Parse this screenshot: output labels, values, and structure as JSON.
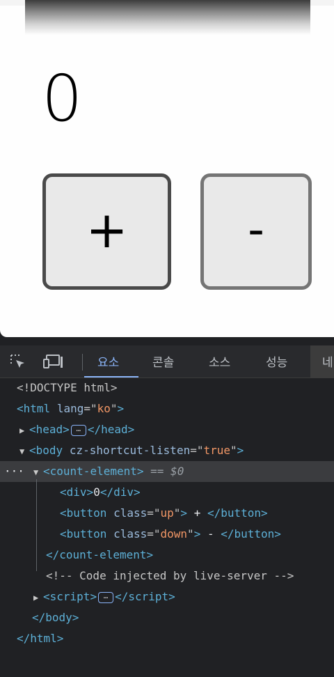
{
  "counter": {
    "value": "0",
    "plus_label": "+",
    "minus_label": "-"
  },
  "devtools": {
    "tabs": [
      "요소",
      "콘솔",
      "소스",
      "성능",
      "네"
    ],
    "more_dots": "···",
    "selected_suffix": "== $0",
    "dom": {
      "doctype": "<!DOCTYPE html>",
      "html_tag": "html",
      "html_attr_name": "lang",
      "html_attr_value": "ko",
      "head_tag": "head",
      "body_tag": "body",
      "body_attr_name": "cz-shortcut-listen",
      "body_attr_value": "true",
      "custom_tag": "count-element",
      "div_tag": "div",
      "div_text": "0",
      "button_tag": "button",
      "button_attr_name": "class",
      "button_up_class": "up",
      "button_up_text": " + ",
      "button_down_class": "down",
      "button_down_text": " - ",
      "comment": "<!-- Code injected by live-server -->",
      "script_tag": "script"
    }
  }
}
